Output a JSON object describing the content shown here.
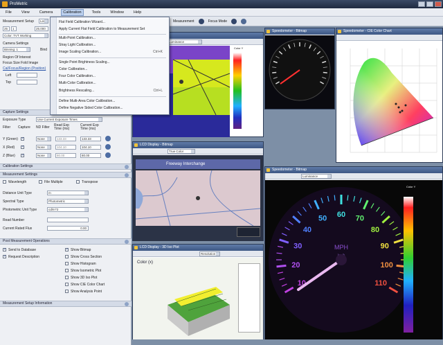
{
  "app": {
    "title": "ProMetric"
  },
  "menubar": [
    "File",
    "View",
    "Camera",
    "Calibration",
    "Tools",
    "Window",
    "Help"
  ],
  "calibration_menu": {
    "items": [
      {
        "label": "Flat Field Calibration Wizard...",
        "key": ""
      },
      {
        "label": "Apply Current Flat Field Calibration to Measurement Set",
        "key": ""
      },
      {
        "sep": true
      },
      {
        "label": "Multi-Point Calibration...",
        "key": ""
      },
      {
        "label": "Stray Light Calibration...",
        "key": ""
      },
      {
        "label": "Image Scaling Calibration...",
        "key": "Ctrl+K"
      },
      {
        "sep": true
      },
      {
        "label": "Single Point Brightness Scaling...",
        "key": ""
      },
      {
        "label": "Color Calibration...",
        "key": ""
      },
      {
        "label": "Four Color Calibration...",
        "key": ""
      },
      {
        "label": "Multi-Color Calibration...",
        "key": ""
      },
      {
        "label": "Brightness Rescaling...",
        "key": "Ctrl+L"
      },
      {
        "sep": true
      },
      {
        "label": "Define Multi-Area Color Calibration...",
        "key": ""
      },
      {
        "label": "Define Negative Sided Color Calibration...",
        "key": ""
      }
    ]
  },
  "toolbar": {
    "measurement": "Measurement",
    "focus_mode": "Focus Mode"
  },
  "left_panel": {
    "setup_label": "Measurement Setup",
    "setup_value": "Lens",
    "sets": [
      "25",
      "1"
    ],
    "sets_value": "25.000",
    "color_label": "Color: TVT Working",
    "camera_settings": "Camera Settings",
    "binning": "Binning: 1",
    "binning_val": "1",
    "bind": "Bind",
    "region_label": "Region Of Interest",
    "focus_label": "Focus Size Fold Image",
    "cal_link": "Cal/Focus/Region (Position)",
    "left_label": "Left",
    "top_label": "Top",
    "capture_settings": "Capture Settings",
    "exposure_type_label": "Exposure Type",
    "exposure_type": "Use Current Exposure Times",
    "filter_headers": [
      "Filter",
      "Capture",
      "ND Filter",
      "Read Exp Time (ms)",
      "Current Exp Time (ms)"
    ],
    "filters": [
      {
        "name": "Y (Green)",
        "nd": "None",
        "read": "133.33",
        "cur": "133.33"
      },
      {
        "name": "X (Red)",
        "nd": "None",
        "read": "104.10",
        "cur": "104.10"
      },
      {
        "name": "Z (Blue)",
        "nd": "None",
        "read": "80.00",
        "cur": "80.00"
      }
    ],
    "calibration_settings": "Calibration Settings",
    "measurement_settings": "Measurement Settings",
    "measurement_opts": [
      "Wavelength",
      "File Multiple",
      "Transpose"
    ],
    "unit_rows": [
      {
        "label": "Distance Unit Type",
        "value": "m"
      },
      {
        "label": "Spectral Type",
        "value": "Photometric"
      },
      {
        "label": "Photometric Unit Type",
        "value": "cd/m^2"
      }
    ],
    "read_number_label": "Read Number",
    "current_rated_label": "Current Rated Flux",
    "current_rated_value": "0.00",
    "post_ops": "Post Measurement Operations",
    "post_left": [
      {
        "label": "Send to Database",
        "on": true
      },
      {
        "label": "Request Description",
        "on": true
      }
    ],
    "post_right": [
      {
        "label": "Show Bitmap",
        "on": true
      },
      {
        "label": "Show Cross Section",
        "on": false
      },
      {
        "label": "Show Histogram",
        "on": false
      },
      {
        "label": "Show Isometric Plot",
        "on": false
      },
      {
        "label": "Show 3D Iso Plot",
        "on": false
      },
      {
        "label": "Show CIE Color Chart",
        "on": false
      },
      {
        "label": "Show Analysis Point",
        "on": false
      }
    ],
    "measurement_setup_info": "Measurement Setup Information"
  },
  "windows": {
    "map_top": {
      "title": "",
      "tool": "Luminance",
      "scale_title": "Color Y"
    },
    "speedo_small": {
      "title": "Speedometer - Bitmap"
    },
    "cie": {
      "title": "Speedometer - CIE Color Chart"
    },
    "gps": {
      "title": "LCD Display - Bitmap",
      "tool": "True Color",
      "banner": "Freeway Interchange"
    },
    "speedo_large": {
      "title": "Speedometer - Bitmap",
      "tool": "Luminance",
      "scale_title": "Color Y"
    },
    "plot3d": {
      "title": "LCD Display - 3D Iso Plot",
      "tool": "Resolution",
      "heading": "Color (x)"
    }
  },
  "gauge": {
    "numbers": [
      "10",
      "20",
      "30",
      "40",
      "50",
      "60",
      "70",
      "80",
      "90",
      "100",
      "110"
    ],
    "unit_top": "MPH",
    "unit_bottom": "km/h"
  }
}
